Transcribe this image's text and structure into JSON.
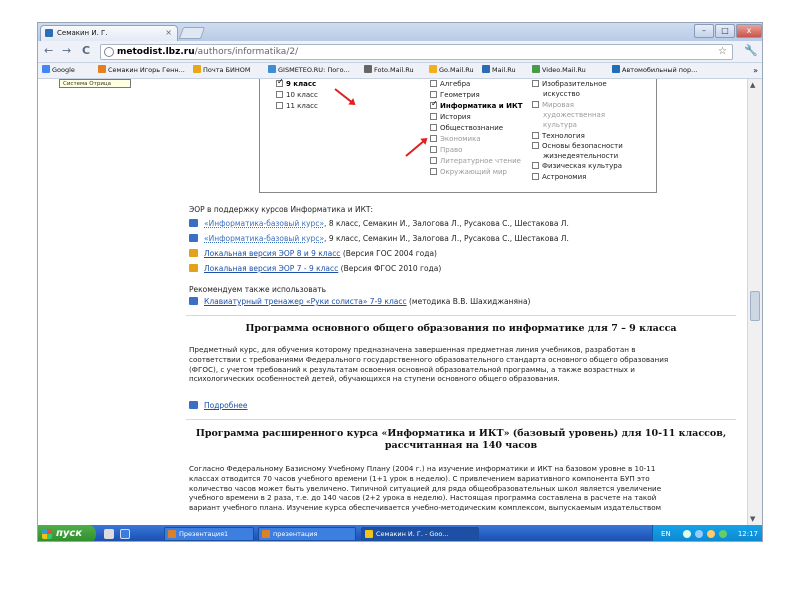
{
  "window": {
    "tab_title": "Семакин И. Г.",
    "tab_close": "×",
    "controls": {
      "minimize": "–",
      "maximize": "□",
      "close": "x"
    }
  },
  "toolbar": {
    "back": "←",
    "forward": "→",
    "reload": "C",
    "url_host": "metodist.lbz.ru",
    "url_path": "/authors/informatika/2/",
    "star": "☆",
    "menu": "🔧"
  },
  "bookmarks": [
    {
      "label": "Google",
      "color": "#4285f4"
    },
    {
      "label": "Семакин Игорь Генн...",
      "color": "#e67e22"
    },
    {
      "label": "Почта БИНОМ",
      "color": "#e6a817"
    },
    {
      "label": "GISMETEO.RU: Пого...",
      "color": "#3a8fd6"
    },
    {
      "label": "Foto.Mail.Ru",
      "color": "#666666"
    },
    {
      "label": "Go.Mail.Ru",
      "color": "#f2b01e"
    },
    {
      "label": "Mail.Ru",
      "color": "#2b6cb0"
    },
    {
      "label": "Video.Mail.Ru",
      "color": "#4a9a4a"
    },
    {
      "label": "Автомобильный пор...",
      "color": "#1f6fb8"
    }
  ],
  "bookmarks_more": "»",
  "tooltip": "Система Отрица",
  "subjects": {
    "grades": [
      {
        "label": "9 класс",
        "checked": true
      },
      {
        "label": "10 класс",
        "checked": false
      },
      {
        "label": "11 класс",
        "checked": false
      }
    ],
    "col2": [
      {
        "label": "Алгебра",
        "checked": false,
        "grey": false
      },
      {
        "label": "Геометрия",
        "checked": false,
        "grey": false
      },
      {
        "label": "Информатика и ИКТ",
        "checked": true,
        "grey": false
      },
      {
        "label": "История",
        "checked": false,
        "grey": false
      },
      {
        "label": "Обществознание",
        "checked": false,
        "grey": false
      },
      {
        "label": "Экономика",
        "checked": false,
        "grey": true
      },
      {
        "label": "Право",
        "checked": false,
        "grey": true
      },
      {
        "label": "Литературное чтение",
        "checked": false,
        "grey": true
      },
      {
        "label": "Окружающий мир",
        "checked": false,
        "grey": true
      }
    ],
    "col3_lines": [
      {
        "label": "Изобразительное",
        "cb": true,
        "grey": false
      },
      {
        "label": "искусство",
        "cb": false,
        "grey": false
      },
      {
        "label": "Мировая",
        "cb": true,
        "grey": true
      },
      {
        "label": "художественная",
        "cb": false,
        "grey": true
      },
      {
        "label": "культура",
        "cb": false,
        "grey": true
      },
      {
        "label": "Технология",
        "cb": true,
        "grey": false
      },
      {
        "label": "Основы безопасности",
        "cb": true,
        "grey": false
      },
      {
        "label": "жизнедеятельности",
        "cb": false,
        "grey": false
      },
      {
        "label": "Физическая культура",
        "cb": true,
        "grey": false
      },
      {
        "label": "Астрономия",
        "cb": true,
        "grey": false
      }
    ]
  },
  "eor": {
    "heading": "ЭОР в поддержку курсов Информатика и ИКТ:",
    "items": [
      {
        "link": "«Информатика-базовый курс»",
        "rest": ", 8 класс, Семакин И., Залогова Л., Русакова С., Шестакова Л.",
        "icon": "blue",
        "dotted": true
      },
      {
        "link": "«Информатика-базовый курс»",
        "rest": ", 9 класс, Семакин И., Залогова Л., Русакова С., Шестакова Л.",
        "icon": "blue",
        "dotted": true
      },
      {
        "link": "Локальная версия ЭОР 8 и 9 класс",
        "rest": " (Версия ГОС 2004 года)",
        "icon": "yellow",
        "dotted": false
      },
      {
        "link": "Локальная версия ЭОР 7 - 9 класс",
        "rest": " (Версия ФГОС 2010 года)",
        "icon": "yellow",
        "dotted": false
      }
    ],
    "recommend": "Рекомендуем также использовать",
    "recommend_link": "Клавиатурный тренажер «Руки солиста» 7-9 класс",
    "recommend_rest": " (методика В.В. Шахиджаняна)"
  },
  "section1": {
    "title": "Программа основного общего образования по информатике для 7 – 9 класса",
    "lines": [
      "Предметный курс, для обучения которому предназначена завершенная предметная линия учебников, разработан в",
      "соответствии с требованиями Федерального государственного образовательного стандарта основного общего образования",
      "(ФГОС), с учетом требований к результатам освоения основной образовательной программы, а также возрастных и",
      "психологических особенностей детей, обучающихся на ступени основного общего образования."
    ],
    "more": "Подробнее"
  },
  "section2": {
    "title_line1": "Программа расширенного курса «Информатика и ИКТ» (базовый уровень) для 10-11 классов,",
    "title_line2": "рассчитанная на 140 часов",
    "lines": [
      "Согласно Федеральному Базисному Учебному Плану (2004 г.) на изучение информатики и ИКТ на базовом уровне в 10-11",
      "классах отводится 70 часов учебного времени (1+1 урок в неделю). С привлечением вариативного компонента БУП это",
      "количество часов может быть увеличено. Типичной ситуацией для ряда общеобразовательных школ является увеличение",
      "учебного времени в 2 раза, т.е. до 140 часов (2+2 урока в неделю). Настоящая программа составлена в расчете на такой",
      "вариант учебного плана. Изучение курса обеспечивается учебно-методическим комплексом, выпускаемым издательством"
    ]
  },
  "taskbar": {
    "start": "пуск",
    "tasks": [
      {
        "label": "Презентация1",
        "color": "#d9822b"
      },
      {
        "label": "презентация",
        "color": "#d9822b"
      },
      {
        "label": "Семакин И. Г. - Goo...",
        "color": "#f0c419"
      }
    ],
    "lang": "EN",
    "clock": "12:17"
  }
}
